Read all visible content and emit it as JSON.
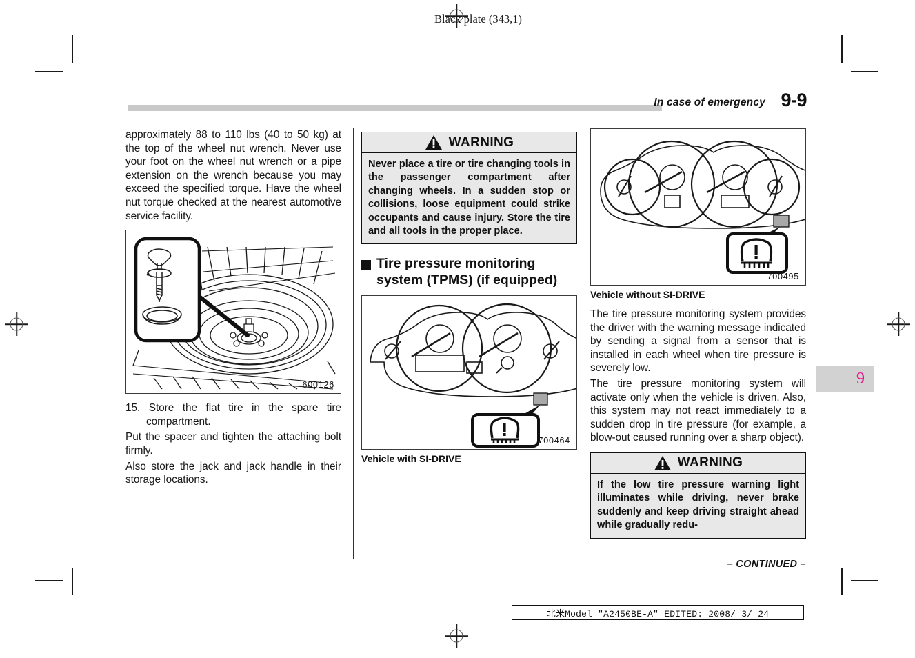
{
  "page": {
    "black_plate": "Black plate (343,1)",
    "running_head": "In case of emergency",
    "page_number": "9-9",
    "thumb_tab": "9",
    "continued": "– CONTINUED –",
    "edit_footer": "北米Model \"A2450BE-A\"  EDITED:  2008/ 3/ 24"
  },
  "column_left": {
    "paragraph_1": "approximately 88 to 110 lbs (40 to 50 kg) at the top of the wheel nut wrench. Never use your foot on the wheel nut wrench or a pipe extension on the wrench because you may exceed the specified torque. Have the wheel nut torque checked at the nearest automotive service facility.",
    "figure": {
      "number": "600126",
      "alt": "spare-tire-compartment-attaching-bolt"
    },
    "step_15": "15. Store the flat tire in the spare tire compartment.",
    "paragraph_2": "Put the spacer and tighten the attaching bolt firmly.",
    "paragraph_3": "Also store the jack and jack handle in their storage locations."
  },
  "column_middle": {
    "warning": {
      "label": "WARNING",
      "text": "Never place a tire or tire changing tools in the passenger compartment after changing wheels. In a sudden stop or collisions, loose equipment could strike occupants and cause injury. Store the tire and all tools in the proper place."
    },
    "heading": "Tire pressure monitoring system (TPMS) (if equipped)",
    "figure": {
      "number": "700464",
      "caption": "Vehicle with SI-DRIVE",
      "alt": "instrument-cluster-with-si-drive"
    }
  },
  "column_right": {
    "figure": {
      "number": "700495",
      "caption": "Vehicle without SI-DRIVE",
      "alt": "instrument-cluster-without-si-drive"
    },
    "paragraph_1": "The tire pressure monitoring system provides the driver with the warning message indicated by sending a signal from a sensor that is installed in each wheel when tire pressure is severely low.",
    "paragraph_2": "The tire pressure monitoring system will activate only when the vehicle is driven. Also, this system may not react immediately to a sudden drop in tire pressure (for example, a blow-out caused running over a sharp object).",
    "warning": {
      "label": "WARNING",
      "text": "If the low tire pressure warning light illuminates while driving, never brake suddenly and keep driving straight ahead while gradually redu-"
    }
  },
  "colors": {
    "tab_number": "#ec0f8c",
    "rule_bar": "#c9c9c9",
    "warning_fill": "#e8e8e8",
    "ink": "#111111"
  }
}
